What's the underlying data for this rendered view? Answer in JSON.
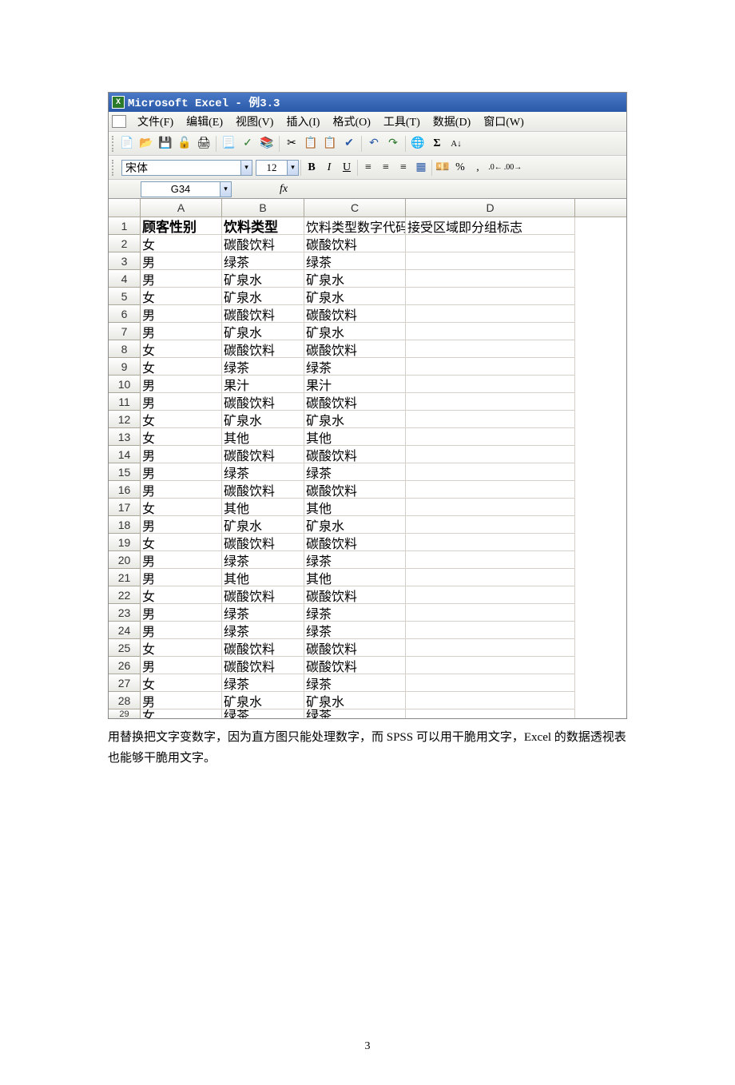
{
  "app_title": "Microsoft Excel - 例3.3",
  "menu": {
    "file": "文件(F)",
    "edit": "编辑(E)",
    "view": "视图(V)",
    "insert": "插入(I)",
    "format": "格式(O)",
    "tools": "工具(T)",
    "data": "数据(D)",
    "window": "窗口(W)"
  },
  "font_name": "宋体",
  "font_size": "12",
  "name_box": "G34",
  "fx": "fx",
  "columns": [
    "A",
    "B",
    "C",
    "D"
  ],
  "headers": {
    "A": "顾客性别",
    "B": "饮料类型",
    "C": "饮料类型数字代码",
    "D": "接受区域即分组标志"
  },
  "rows": [
    {
      "n": "1"
    },
    {
      "n": "2",
      "A": "女",
      "B": "碳酸饮料",
      "C": "碳酸饮料",
      "D": ""
    },
    {
      "n": "3",
      "A": "男",
      "B": "绿茶",
      "C": "绿茶",
      "D": ""
    },
    {
      "n": "4",
      "A": "男",
      "B": "矿泉水",
      "C": "矿泉水",
      "D": ""
    },
    {
      "n": "5",
      "A": "女",
      "B": "矿泉水",
      "C": "矿泉水",
      "D": ""
    },
    {
      "n": "6",
      "A": "男",
      "B": "碳酸饮料",
      "C": "碳酸饮料",
      "D": ""
    },
    {
      "n": "7",
      "A": "男",
      "B": "矿泉水",
      "C": "矿泉水",
      "D": ""
    },
    {
      "n": "8",
      "A": "女",
      "B": "碳酸饮料",
      "C": "碳酸饮料",
      "D": ""
    },
    {
      "n": "9",
      "A": "女",
      "B": "绿茶",
      "C": "绿茶",
      "D": ""
    },
    {
      "n": "10",
      "A": "男",
      "B": "果汁",
      "C": "果汁",
      "D": ""
    },
    {
      "n": "11",
      "A": "男",
      "B": "碳酸饮料",
      "C": "碳酸饮料",
      "D": ""
    },
    {
      "n": "12",
      "A": "女",
      "B": "矿泉水",
      "C": "矿泉水",
      "D": ""
    },
    {
      "n": "13",
      "A": "女",
      "B": "其他",
      "C": "其他",
      "D": ""
    },
    {
      "n": "14",
      "A": "男",
      "B": "碳酸饮料",
      "C": "碳酸饮料",
      "D": ""
    },
    {
      "n": "15",
      "A": "男",
      "B": "绿茶",
      "C": "绿茶",
      "D": ""
    },
    {
      "n": "16",
      "A": "男",
      "B": "碳酸饮料",
      "C": "碳酸饮料",
      "D": ""
    },
    {
      "n": "17",
      "A": "女",
      "B": "其他",
      "C": "其他",
      "D": ""
    },
    {
      "n": "18",
      "A": "男",
      "B": "矿泉水",
      "C": "矿泉水",
      "D": ""
    },
    {
      "n": "19",
      "A": "女",
      "B": "碳酸饮料",
      "C": "碳酸饮料",
      "D": ""
    },
    {
      "n": "20",
      "A": "男",
      "B": "绿茶",
      "C": "绿茶",
      "D": ""
    },
    {
      "n": "21",
      "A": "男",
      "B": "其他",
      "C": "其他",
      "D": ""
    },
    {
      "n": "22",
      "A": "女",
      "B": "碳酸饮料",
      "C": "碳酸饮料",
      "D": ""
    },
    {
      "n": "23",
      "A": "男",
      "B": "绿茶",
      "C": "绿茶",
      "D": ""
    },
    {
      "n": "24",
      "A": "男",
      "B": "绿茶",
      "C": "绿茶",
      "D": ""
    },
    {
      "n": "25",
      "A": "女",
      "B": "碳酸饮料",
      "C": "碳酸饮料",
      "D": ""
    },
    {
      "n": "26",
      "A": "男",
      "B": "碳酸饮料",
      "C": "碳酸饮料",
      "D": ""
    },
    {
      "n": "27",
      "A": "女",
      "B": "绿茶",
      "C": "绿茶",
      "D": ""
    },
    {
      "n": "28",
      "A": "男",
      "B": "矿泉水",
      "C": "矿泉水",
      "D": ""
    }
  ],
  "partial_row": {
    "n": "29",
    "A": "女",
    "B": "绿茶",
    "C": "绿茶",
    "D": ""
  },
  "caption": "用替换把文字变数字，因为直方图只能处理数字，而 SPSS 可以用干脆用文字，Excel 的数据透视表也能够干脆用文字。",
  "page_number": "3"
}
